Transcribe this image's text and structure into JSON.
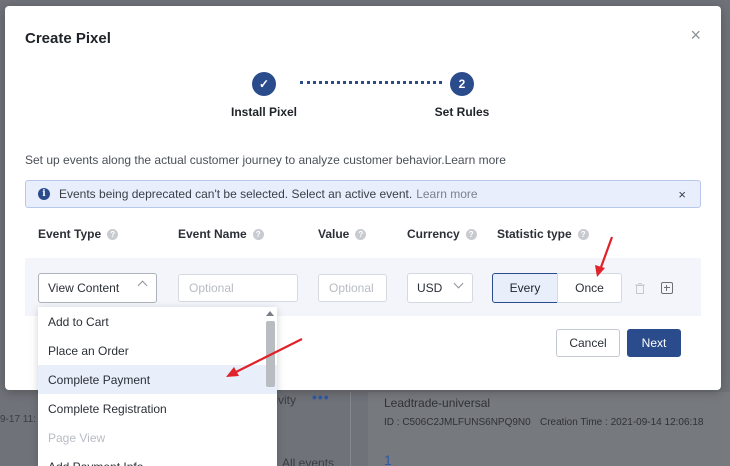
{
  "background": {
    "left_time": "9-17 11:",
    "activity": "tivity",
    "more_dots": "•••",
    "all_events": "All events",
    "card_title": "Leadtrade-universal",
    "card_id": "ID : C506C2JMLFUNS6NPQ9N0",
    "card_time": "Creation Time : 2021-09-14 12:06:18",
    "card_number": "1"
  },
  "modal": {
    "title": "Create Pixel",
    "close": "×"
  },
  "steps": [
    {
      "number": "✓",
      "label": "Install Pixel",
      "status": "done"
    },
    {
      "number": "2",
      "label": "Set Rules",
      "status": "active"
    }
  ],
  "intro": {
    "text": "Set up events along the actual customer journey to analyze customer behavior.",
    "link": "Learn more"
  },
  "notice": {
    "icon": "i",
    "text": "Events being deprecated can't be selected. Select an active event.",
    "link": "Learn more",
    "close": "×"
  },
  "columns": {
    "event_type": "Event Type",
    "event_name": "Event Name",
    "value": "Value",
    "currency": "Currency",
    "statistic_type": "Statistic type",
    "help_icon": "?"
  },
  "row": {
    "event_type_value": "View Content",
    "event_name_placeholder": "Optional",
    "value_placeholder": "Optional",
    "currency_value": "USD",
    "statistic_options": [
      "Every",
      "Once"
    ],
    "statistic_selected": "Every"
  },
  "buttons": {
    "cancel": "Cancel",
    "next": "Next"
  },
  "dropdown": {
    "items": [
      {
        "label": "Add to Cart",
        "state": "normal"
      },
      {
        "label": "Place an Order",
        "state": "normal"
      },
      {
        "label": "Complete Payment",
        "state": "highlighted"
      },
      {
        "label": "Complete Registration",
        "state": "normal"
      },
      {
        "label": "Page View",
        "state": "disabled"
      },
      {
        "label": "Add Payment Info",
        "state": "normal"
      }
    ]
  },
  "colors": {
    "primary": "#2b4c8c",
    "annotation_arrow": "#e0232a",
    "highlight_bg": "#e9eefb"
  }
}
